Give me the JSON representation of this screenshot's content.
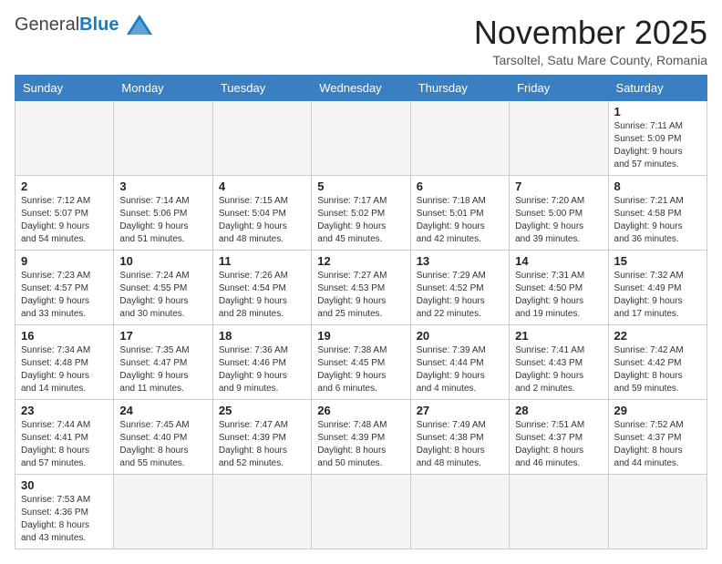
{
  "header": {
    "logo_general": "General",
    "logo_blue": "Blue",
    "month_title": "November 2025",
    "subtitle": "Tarsoltel, Satu Mare County, Romania"
  },
  "weekdays": [
    "Sunday",
    "Monday",
    "Tuesday",
    "Wednesday",
    "Thursday",
    "Friday",
    "Saturday"
  ],
  "days": [
    {
      "num": "",
      "info": ""
    },
    {
      "num": "",
      "info": ""
    },
    {
      "num": "",
      "info": ""
    },
    {
      "num": "",
      "info": ""
    },
    {
      "num": "",
      "info": ""
    },
    {
      "num": "",
      "info": ""
    },
    {
      "num": "1",
      "info": "Sunrise: 7:11 AM\nSunset: 5:09 PM\nDaylight: 9 hours\nand 57 minutes."
    },
    {
      "num": "2",
      "info": "Sunrise: 7:12 AM\nSunset: 5:07 PM\nDaylight: 9 hours\nand 54 minutes."
    },
    {
      "num": "3",
      "info": "Sunrise: 7:14 AM\nSunset: 5:06 PM\nDaylight: 9 hours\nand 51 minutes."
    },
    {
      "num": "4",
      "info": "Sunrise: 7:15 AM\nSunset: 5:04 PM\nDaylight: 9 hours\nand 48 minutes."
    },
    {
      "num": "5",
      "info": "Sunrise: 7:17 AM\nSunset: 5:02 PM\nDaylight: 9 hours\nand 45 minutes."
    },
    {
      "num": "6",
      "info": "Sunrise: 7:18 AM\nSunset: 5:01 PM\nDaylight: 9 hours\nand 42 minutes."
    },
    {
      "num": "7",
      "info": "Sunrise: 7:20 AM\nSunset: 5:00 PM\nDaylight: 9 hours\nand 39 minutes."
    },
    {
      "num": "8",
      "info": "Sunrise: 7:21 AM\nSunset: 4:58 PM\nDaylight: 9 hours\nand 36 minutes."
    },
    {
      "num": "9",
      "info": "Sunrise: 7:23 AM\nSunset: 4:57 PM\nDaylight: 9 hours\nand 33 minutes."
    },
    {
      "num": "10",
      "info": "Sunrise: 7:24 AM\nSunset: 4:55 PM\nDaylight: 9 hours\nand 30 minutes."
    },
    {
      "num": "11",
      "info": "Sunrise: 7:26 AM\nSunset: 4:54 PM\nDaylight: 9 hours\nand 28 minutes."
    },
    {
      "num": "12",
      "info": "Sunrise: 7:27 AM\nSunset: 4:53 PM\nDaylight: 9 hours\nand 25 minutes."
    },
    {
      "num": "13",
      "info": "Sunrise: 7:29 AM\nSunset: 4:52 PM\nDaylight: 9 hours\nand 22 minutes."
    },
    {
      "num": "14",
      "info": "Sunrise: 7:31 AM\nSunset: 4:50 PM\nDaylight: 9 hours\nand 19 minutes."
    },
    {
      "num": "15",
      "info": "Sunrise: 7:32 AM\nSunset: 4:49 PM\nDaylight: 9 hours\nand 17 minutes."
    },
    {
      "num": "16",
      "info": "Sunrise: 7:34 AM\nSunset: 4:48 PM\nDaylight: 9 hours\nand 14 minutes."
    },
    {
      "num": "17",
      "info": "Sunrise: 7:35 AM\nSunset: 4:47 PM\nDaylight: 9 hours\nand 11 minutes."
    },
    {
      "num": "18",
      "info": "Sunrise: 7:36 AM\nSunset: 4:46 PM\nDaylight: 9 hours\nand 9 minutes."
    },
    {
      "num": "19",
      "info": "Sunrise: 7:38 AM\nSunset: 4:45 PM\nDaylight: 9 hours\nand 6 minutes."
    },
    {
      "num": "20",
      "info": "Sunrise: 7:39 AM\nSunset: 4:44 PM\nDaylight: 9 hours\nand 4 minutes."
    },
    {
      "num": "21",
      "info": "Sunrise: 7:41 AM\nSunset: 4:43 PM\nDaylight: 9 hours\nand 2 minutes."
    },
    {
      "num": "22",
      "info": "Sunrise: 7:42 AM\nSunset: 4:42 PM\nDaylight: 8 hours\nand 59 minutes."
    },
    {
      "num": "23",
      "info": "Sunrise: 7:44 AM\nSunset: 4:41 PM\nDaylight: 8 hours\nand 57 minutes."
    },
    {
      "num": "24",
      "info": "Sunrise: 7:45 AM\nSunset: 4:40 PM\nDaylight: 8 hours\nand 55 minutes."
    },
    {
      "num": "25",
      "info": "Sunrise: 7:47 AM\nSunset: 4:39 PM\nDaylight: 8 hours\nand 52 minutes."
    },
    {
      "num": "26",
      "info": "Sunrise: 7:48 AM\nSunset: 4:39 PM\nDaylight: 8 hours\nand 50 minutes."
    },
    {
      "num": "27",
      "info": "Sunrise: 7:49 AM\nSunset: 4:38 PM\nDaylight: 8 hours\nand 48 minutes."
    },
    {
      "num": "28",
      "info": "Sunrise: 7:51 AM\nSunset: 4:37 PM\nDaylight: 8 hours\nand 46 minutes."
    },
    {
      "num": "29",
      "info": "Sunrise: 7:52 AM\nSunset: 4:37 PM\nDaylight: 8 hours\nand 44 minutes."
    },
    {
      "num": "30",
      "info": "Sunrise: 7:53 AM\nSunset: 4:36 PM\nDaylight: 8 hours\nand 43 minutes."
    },
    {
      "num": "",
      "info": ""
    },
    {
      "num": "",
      "info": ""
    },
    {
      "num": "",
      "info": ""
    },
    {
      "num": "",
      "info": ""
    },
    {
      "num": "",
      "info": ""
    },
    {
      "num": "",
      "info": ""
    }
  ]
}
